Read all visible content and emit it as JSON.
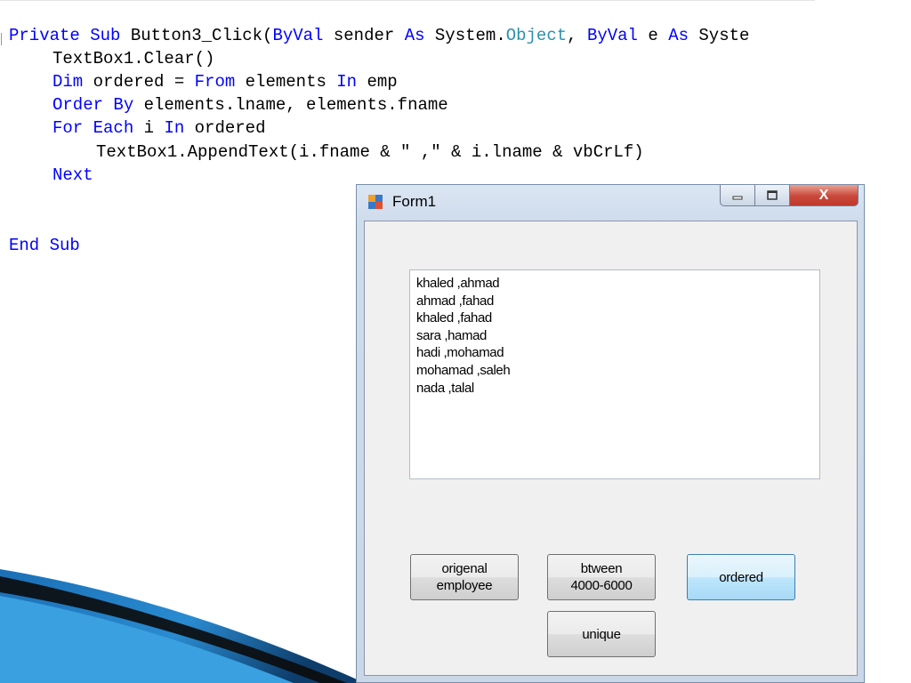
{
  "code": {
    "line1": {
      "kw1": "Private Sub",
      "t1": " Button3_Click(",
      "kw2": "ByVal",
      "t2": " sender ",
      "kw3": "As",
      "t3": " System.",
      "ty1": "Object",
      "t4": ", ",
      "kw4": "ByVal",
      "t5": " e ",
      "kw5": "As",
      "t6": " Syste"
    },
    "line2": {
      "t1": "TextBox1.Clear()"
    },
    "line3": {
      "kw1": "Dim",
      "t1": " ordered = ",
      "kw2": "From",
      "t2": " elements ",
      "kw3": "In",
      "t3": " emp"
    },
    "line4": {
      "kw1": "Order By",
      "t1": " elements.lname, elements.fname"
    },
    "line5": {
      "kw1": "For Each",
      "t1": " i ",
      "kw2": "In",
      "t2": " ordered"
    },
    "line6": {
      "t1": "TextBox1.AppendText(i.fname & \" ,\" & i.lname & vbCrLf)"
    },
    "line7": {
      "kw1": "Next"
    },
    "line8": {
      "kw1": "End Sub"
    }
  },
  "form": {
    "title": "Form1",
    "close_glyph": "X",
    "output_lines": [
      "khaled ,ahmad",
      "ahmad ,fahad",
      "khaled ,fahad",
      "sara ,hamad",
      "hadi ,mohamad",
      "mohamad ,saleh",
      "nada ,talal"
    ],
    "buttons": {
      "original": "origenal\nemployee",
      "between": "btween\n4000-6000",
      "ordered": "ordered",
      "unique": "unique"
    }
  },
  "colors": {
    "keyword": "#0000ff",
    "type": "#2b91af",
    "active_button": "#bee6fd",
    "close_button": "#c9483a"
  }
}
